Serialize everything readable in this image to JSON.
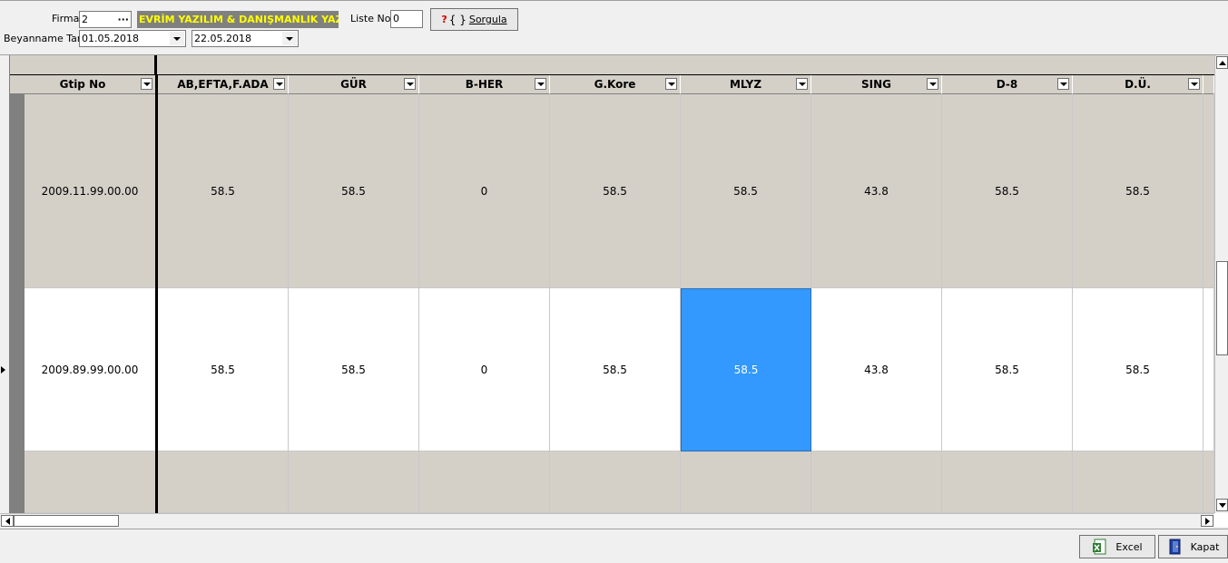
{
  "toolbar": {
    "firma_label": "Firma",
    "firma_value": "2",
    "firma_lookup": "···",
    "company_name": "EVRİM YAZILIM & DANIŞMANLIK YAZ",
    "liste_label": "Liste No",
    "liste_value": "0",
    "query_icon": "?",
    "query_label": "Sorgula",
    "beyanname_label": "Beyanname Tar.",
    "date_from": "01.05.2018",
    "date_to": "22.05.2018"
  },
  "colors": {
    "company_bg": "#808080",
    "company_text": "#ffff00",
    "selected_cell": "#3399ff",
    "row_shaded": "#d4d0c8"
  },
  "grid": {
    "headers": [
      "Gtip No",
      "AB,EFTA,F.ADA",
      "GÜR",
      "B-HER",
      "G.Kore",
      "MLYZ",
      "SING",
      "D-8",
      "D.Ü."
    ],
    "rows": [
      [
        "2009.11.99.00.00",
        "58.5",
        "58.5",
        "0",
        "58.5",
        "58.5",
        "43.8",
        "58.5",
        "58.5"
      ],
      [
        "2009.89.99.00.00",
        "58.5",
        "58.5",
        "0",
        "58.5",
        "58.5",
        "43.8",
        "58.5",
        "58.5"
      ]
    ]
  },
  "footer": {
    "excel_label": "Excel",
    "kapat_label": "Kapat"
  }
}
